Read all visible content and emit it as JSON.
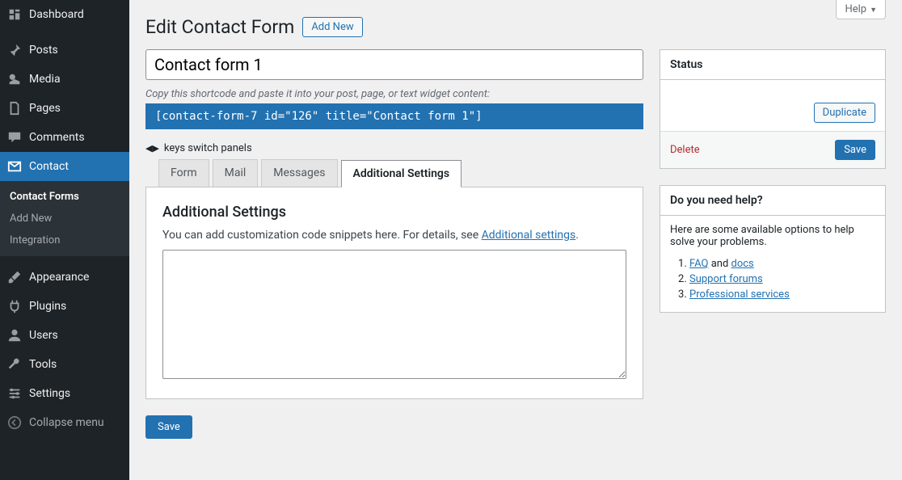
{
  "sidebar": {
    "items": [
      {
        "label": "Dashboard",
        "icon": "dashboard"
      },
      {
        "label": "Posts",
        "icon": "pin"
      },
      {
        "label": "Media",
        "icon": "media"
      },
      {
        "label": "Pages",
        "icon": "page"
      },
      {
        "label": "Comments",
        "icon": "comment"
      },
      {
        "label": "Contact",
        "icon": "mail",
        "active": true
      },
      {
        "label": "Appearance",
        "icon": "brush"
      },
      {
        "label": "Plugins",
        "icon": "plug"
      },
      {
        "label": "Users",
        "icon": "user"
      },
      {
        "label": "Tools",
        "icon": "wrench"
      },
      {
        "label": "Settings",
        "icon": "sliders"
      },
      {
        "label": "Collapse menu",
        "icon": "collapse"
      }
    ],
    "submenu": [
      "Contact Forms",
      "Add New",
      "Integration"
    ],
    "submenu_current": 0
  },
  "help_label": "Help",
  "page_title": "Edit Contact Form",
  "add_new": "Add New",
  "form_title": "Contact form 1",
  "shortcode_hint": "Copy this shortcode and paste it into your post, page, or text widget content:",
  "shortcode": "[contact-form-7 id=\"126\" title=\"Contact form 1\"]",
  "keys_hint": "keys switch panels",
  "tabs": [
    "Form",
    "Mail",
    "Messages",
    "Additional Settings"
  ],
  "active_tab": 3,
  "panel": {
    "title": "Additional Settings",
    "desc_1": "You can add customization code snippets here. For details, see ",
    "desc_link": "Additional settings",
    "desc_2": "."
  },
  "status": {
    "title": "Status",
    "duplicate": "Duplicate",
    "delete": "Delete",
    "save": "Save"
  },
  "help_box": {
    "title": "Do you need help?",
    "text": "Here are some available options to help solve your problems.",
    "items": [
      {
        "a": "FAQ",
        "mid": " and ",
        "b": "docs"
      },
      {
        "a": "Support forums"
      },
      {
        "a": "Professional services"
      }
    ]
  },
  "save_bottom": "Save"
}
